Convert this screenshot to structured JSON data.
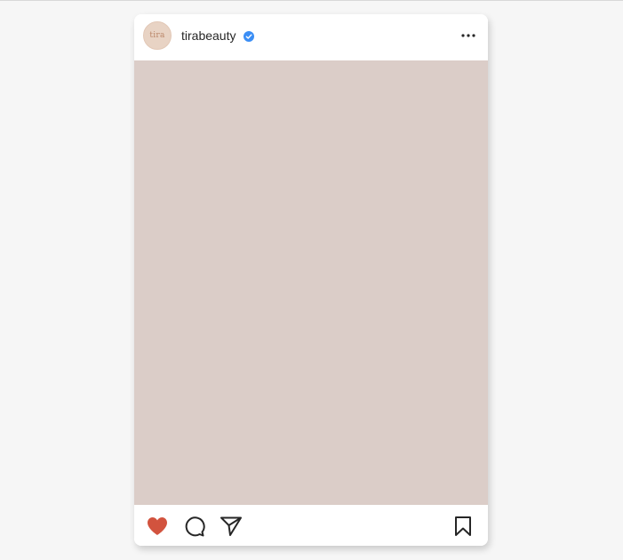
{
  "post": {
    "avatar_text": "tira",
    "username": "tirabeauty",
    "verified": true
  },
  "icons": {
    "more": "more-options-icon",
    "like": "heart-icon",
    "comment": "comment-icon",
    "share": "share-icon",
    "save": "bookmark-icon",
    "verified": "verified-badge-icon"
  },
  "colors": {
    "page_background": "#f6f6f6",
    "media_background": "#dbcdc8",
    "avatar_background": "#e8d3c4",
    "like_active": "#d2533e",
    "verified_blue": "#3b8ef5",
    "text": "#262626"
  },
  "state": {
    "liked": true
  }
}
